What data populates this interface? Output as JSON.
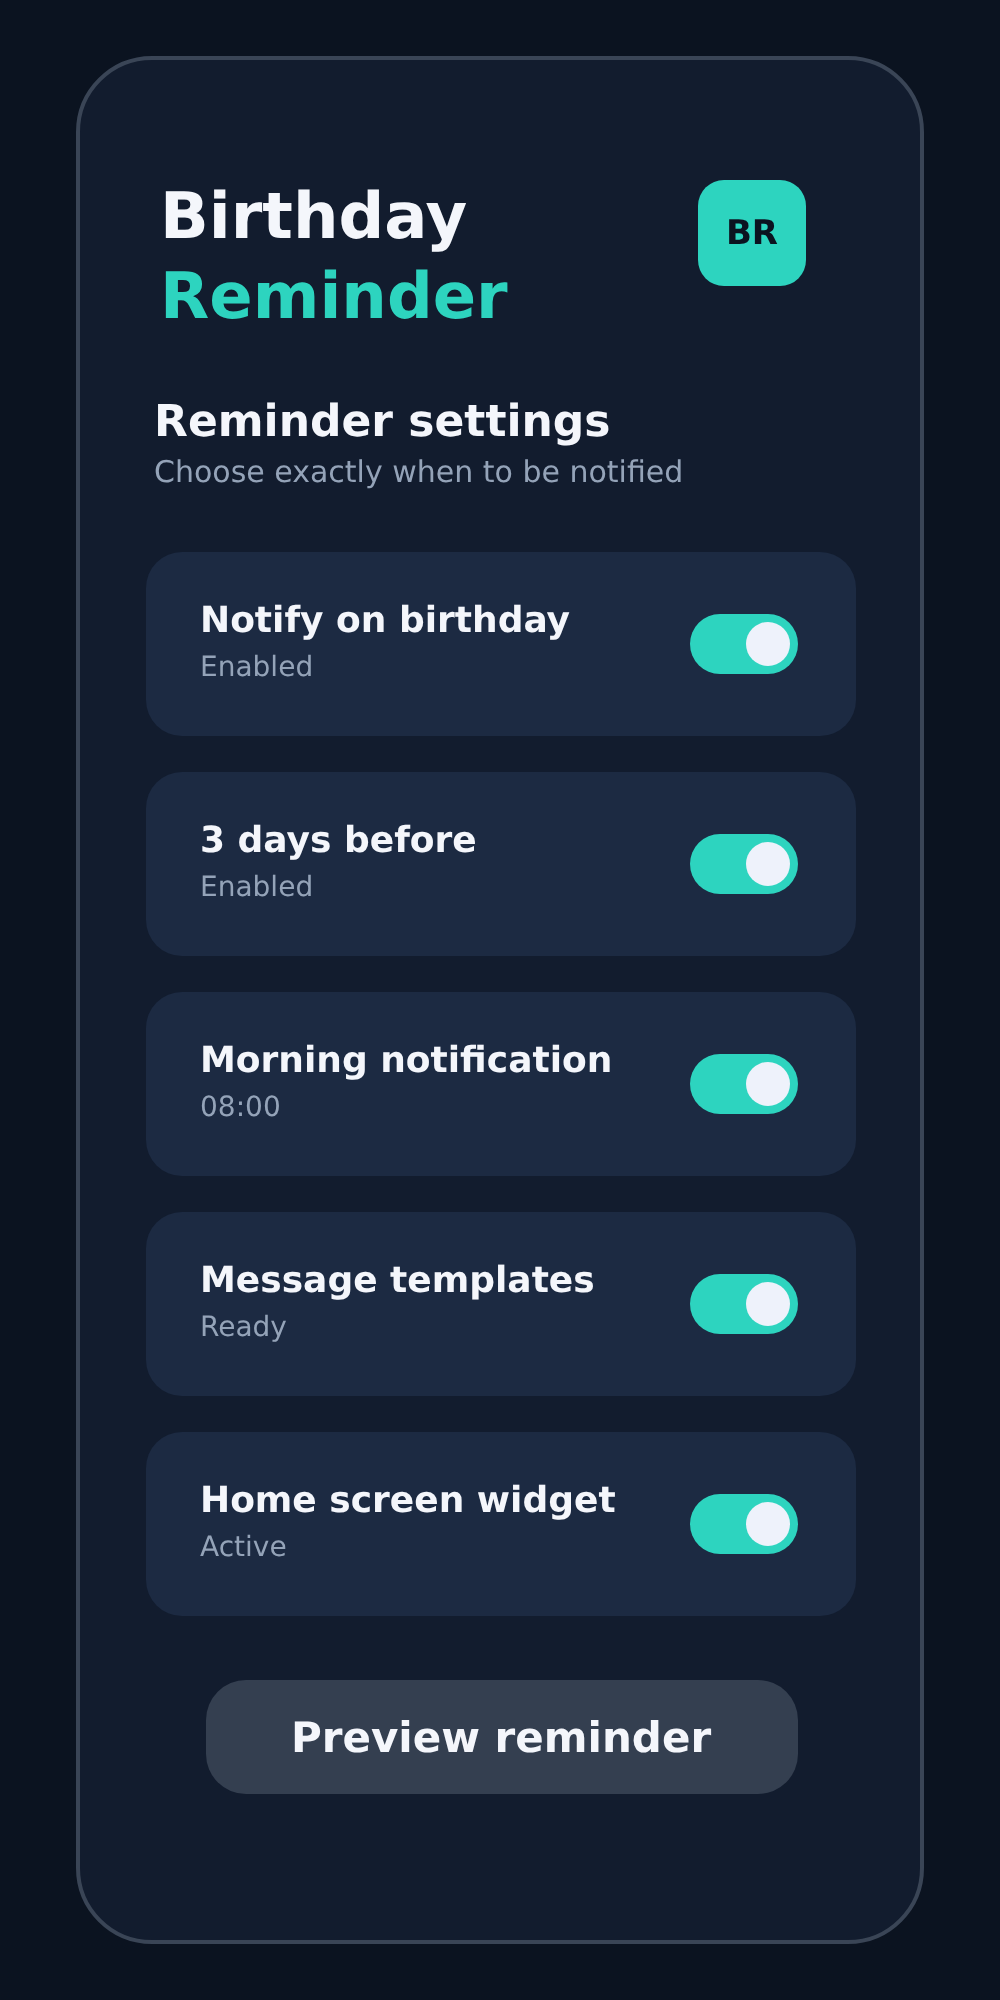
{
  "header": {
    "title_line_1": "Birthday",
    "title_line_2": "Reminder",
    "badge": "BR"
  },
  "section": {
    "title": "Reminder settings",
    "subtitle": "Choose exactly when to be notified"
  },
  "settings": [
    {
      "label": "Notify on birthday",
      "status": "Enabled",
      "on": true
    },
    {
      "label": "3 days before",
      "status": "Enabled",
      "on": true
    },
    {
      "label": "Morning notification",
      "status": "08:00",
      "on": true
    },
    {
      "label": "Message templates",
      "status": "Ready",
      "on": true
    },
    {
      "label": "Home screen widget",
      "status": "Active",
      "on": true
    }
  ],
  "button": "Preview reminder"
}
